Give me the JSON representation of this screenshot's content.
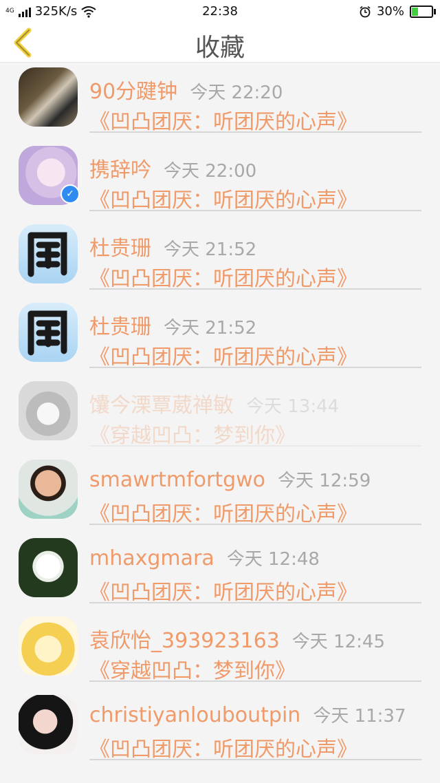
{
  "status_bar": {
    "network": "4G",
    "speed": "325K/s",
    "time": "22:38",
    "battery": "30%",
    "battery_color": "#3fcf3f"
  },
  "nav": {
    "title": "收藏",
    "accent_color": "#f0d040"
  },
  "items": [
    {
      "username": "90分踺钟",
      "time": "今天 22:20",
      "title": "《凹凸团厌：听团厌的心声》",
      "avatar": "avatar-photo-man-on-bench",
      "verified": false,
      "faded": false
    },
    {
      "username": "携辞吟",
      "time": "今天 22:00",
      "title": "《凹凸团厌：听团厌的心声》",
      "avatar": "avatar-anime-girl",
      "verified": true,
      "faded": false
    },
    {
      "username": "杜贵珊",
      "time": "今天 21:52",
      "title": "《凹凸团厌：听团厌的心声》",
      "avatar": "avatar-calligraphy-character",
      "verified": false,
      "faded": false
    },
    {
      "username": "杜贵珊",
      "time": "今天 21:52",
      "title": "《凹凸团厌：听团厌的心声》",
      "avatar": "avatar-calligraphy-character",
      "verified": false,
      "faded": false
    },
    {
      "username": "馕今溧覃葳禅敏",
      "time": "今天 13:44",
      "title": "《穿越凹凸：梦到你》",
      "avatar": "avatar-husky-dog",
      "verified": false,
      "faded": true
    },
    {
      "username": "smawrtmfortgwo",
      "time": "今天 12:59",
      "title": "《凹凸团厌：听团厌的心声》",
      "avatar": "avatar-smiling-man",
      "verified": false,
      "faded": false
    },
    {
      "username": "mhaxgmara",
      "time": "今天 12:48",
      "title": "《凹凸团厌：听团厌的心声》",
      "avatar": "avatar-white-flower",
      "verified": false,
      "faded": false
    },
    {
      "username": "袁欣怡_393923163",
      "time": "今天 12:45",
      "title": "《穿越凹凸：梦到你》",
      "avatar": "avatar-anime-blonde",
      "verified": false,
      "faded": false
    },
    {
      "username": "christiyanlouboutpin",
      "time": "今天 11:37",
      "title": "《凹凸团厌：听团厌的心声》",
      "avatar": "avatar-girl-peace-sign",
      "verified": false,
      "faded": false
    }
  ]
}
